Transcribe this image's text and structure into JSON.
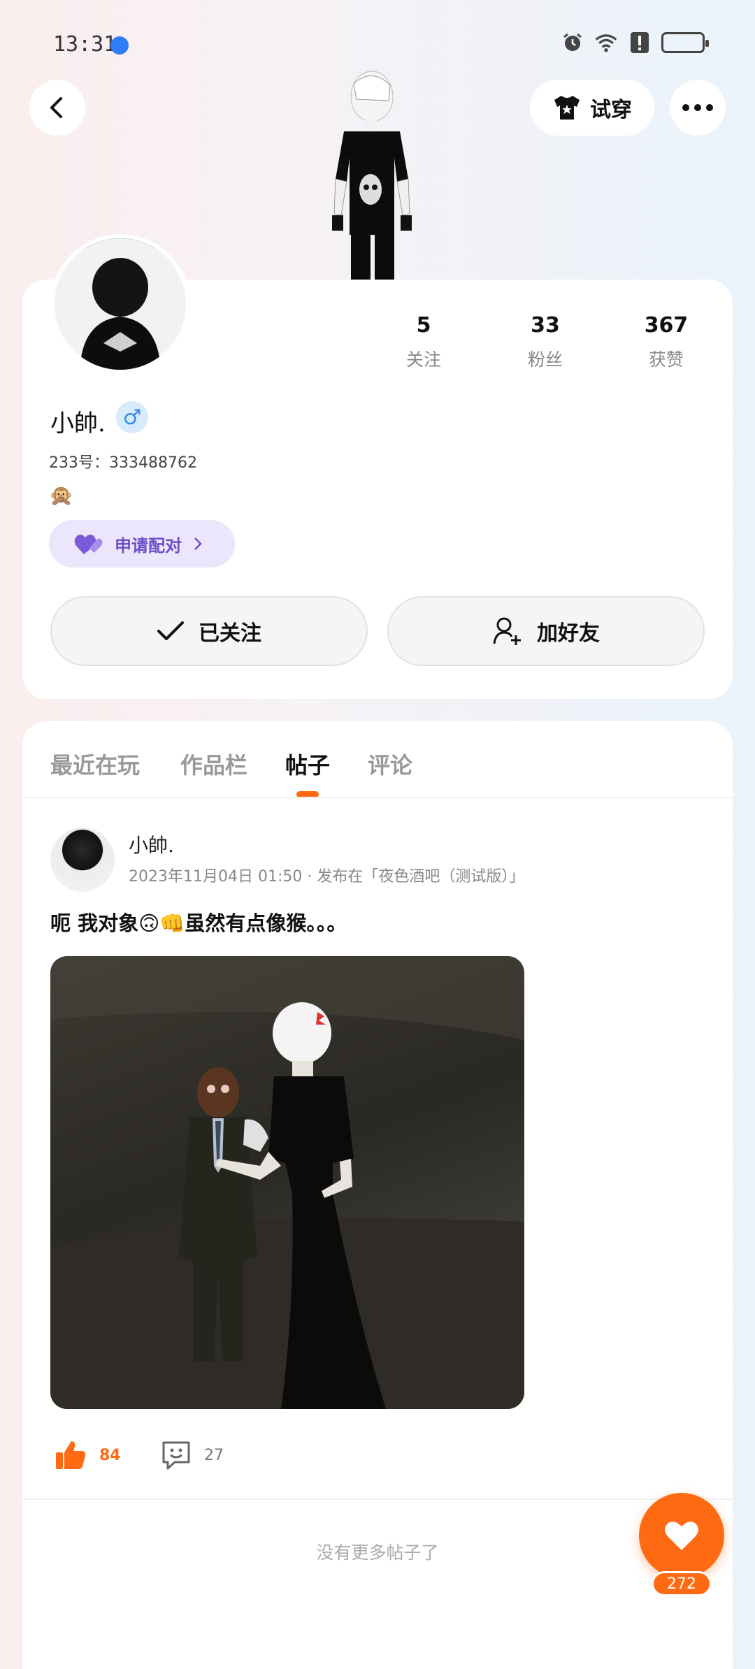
{
  "status_bar": {
    "time": "13:31"
  },
  "header": {
    "tryon_label": "试穿"
  },
  "profile": {
    "stats": [
      {
        "value": "5",
        "label": "关注"
      },
      {
        "value": "33",
        "label": "粉丝"
      },
      {
        "value": "367",
        "label": "获赞"
      }
    ],
    "name": "小帥.",
    "gender_symbol": "♂",
    "uid": "233号：333488762",
    "bio_emoji": "🙊",
    "pair_label": "申请配对",
    "follow_label": "已关注",
    "add_friend_label": "加好友"
  },
  "tabs": [
    {
      "label": "最近在玩",
      "active": false
    },
    {
      "label": "作品栏",
      "active": false
    },
    {
      "label": "帖子",
      "active": true
    },
    {
      "label": "评论",
      "active": false
    }
  ],
  "post": {
    "author": "小帥.",
    "meta": "2023年11月04日 01:50 · 发布在「夜色酒吧（测试版）」",
    "text": "呃 我对象🙃👊虽然有点像猴。。。",
    "likes": "84",
    "comments": "27"
  },
  "footer": {
    "no_more": "没有更多帖子了",
    "fab_count": "272"
  },
  "colors": {
    "accent": "#ff6a13",
    "pair": "#6b4ec9",
    "gender": "#3a8de8"
  }
}
